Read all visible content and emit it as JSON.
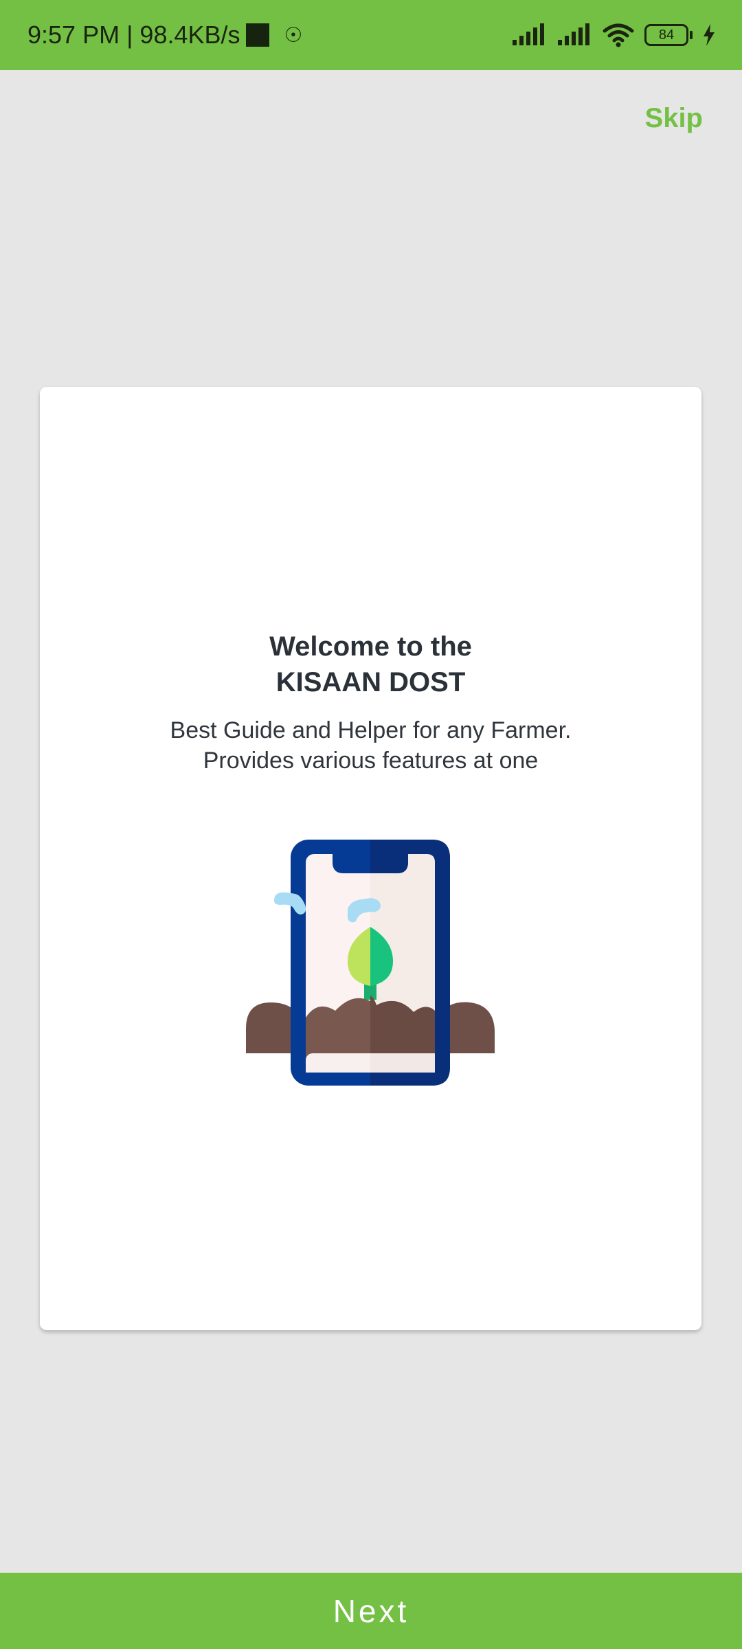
{
  "status_bar": {
    "time_speed": "9:57 PM | 98.4KB/s",
    "battery_level": "84",
    "icons": [
      "signal-icon",
      "signal-icon",
      "wifi-icon",
      "battery-icon",
      "charging-icon"
    ]
  },
  "onboarding": {
    "skip_label": "Skip",
    "title_line1": "Welcome to the",
    "title_line2": "KISAAN DOST",
    "subtitle_line1": "Best Guide and Helper for any Farmer.",
    "subtitle_line2": "Provides various features at one",
    "illustration_icon": "phone-plant-icon"
  },
  "footer": {
    "next_label": "Next"
  },
  "colors": {
    "accent_green": "#74c044",
    "background": "#e6e6e6",
    "card": "#ffffff",
    "title_text": "#2a3138"
  }
}
